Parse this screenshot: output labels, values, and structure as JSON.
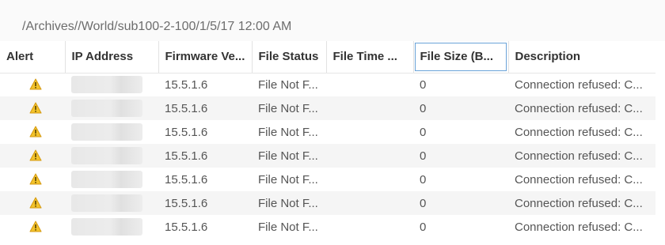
{
  "path": "/Archives//World/sub100-2-100/1/5/17 12:00 AM",
  "columns": [
    {
      "label": "Alert"
    },
    {
      "label": "IP Address"
    },
    {
      "label": "Firmware Ve..."
    },
    {
      "label": "File Status"
    },
    {
      "label": "File Time ..."
    },
    {
      "label": "File Size (B..."
    },
    {
      "label": "Description"
    }
  ],
  "rows": [
    {
      "alert_icon": "warning-icon",
      "ip": "",
      "firmware": "15.5.1.6",
      "file_status": "File Not F...",
      "file_time": "",
      "file_size": "0",
      "description": "Connection refused: C..."
    },
    {
      "alert_icon": "warning-icon",
      "ip": "",
      "firmware": "15.5.1.6",
      "file_status": "File Not F...",
      "file_time": "",
      "file_size": "0",
      "description": "Connection refused: C..."
    },
    {
      "alert_icon": "warning-icon",
      "ip": "",
      "firmware": "15.5.1.6",
      "file_status": "File Not F...",
      "file_time": "",
      "file_size": "0",
      "description": "Connection refused: C..."
    },
    {
      "alert_icon": "warning-icon",
      "ip": "",
      "firmware": "15.5.1.6",
      "file_status": "File Not F...",
      "file_time": "",
      "file_size": "0",
      "description": "Connection refused: C..."
    },
    {
      "alert_icon": "warning-icon",
      "ip": "",
      "firmware": "15.5.1.6",
      "file_status": "File Not F...",
      "file_time": "",
      "file_size": "0",
      "description": "Connection refused: C..."
    },
    {
      "alert_icon": "warning-icon",
      "ip": "",
      "firmware": "15.5.1.6",
      "file_status": "File Not F...",
      "file_time": "",
      "file_size": "0",
      "description": "Connection refused: C..."
    },
    {
      "alert_icon": "warning-icon",
      "ip": "",
      "firmware": "15.5.1.6",
      "file_status": "File Not F...",
      "file_time": "",
      "file_size": "0",
      "description": "Connection refused: C..."
    }
  ],
  "colors": {
    "warning_fill": "#f3c32b",
    "warning_stroke": "#d59a12",
    "active_header_outline": "#6aa3d8"
  }
}
